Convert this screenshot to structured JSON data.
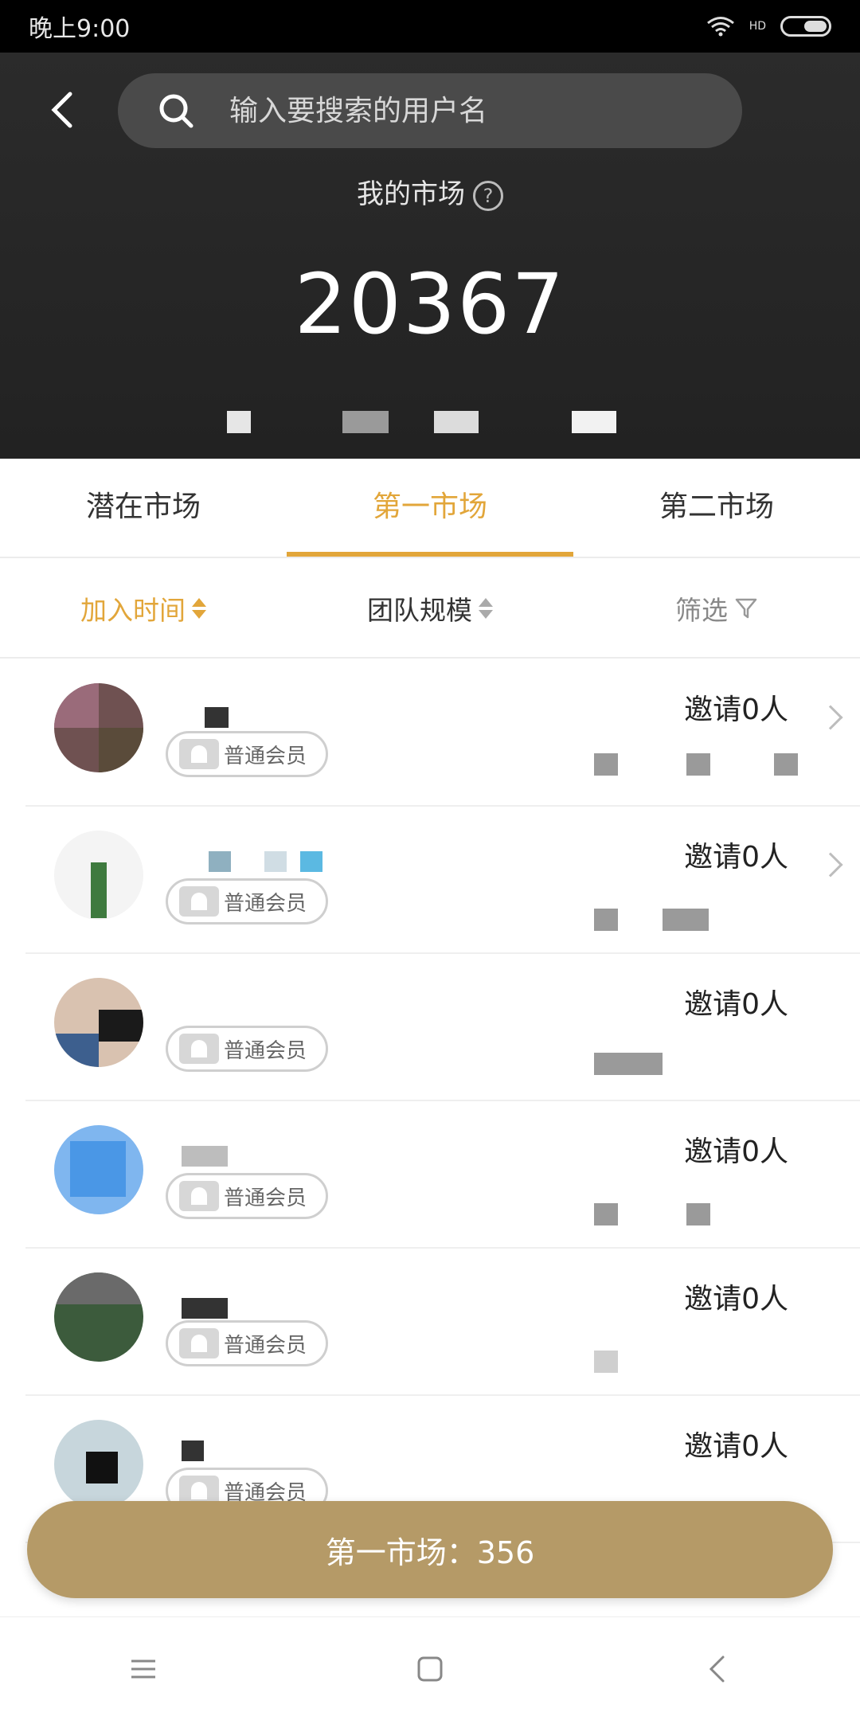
{
  "status_bar": {
    "time": "晚上9:00",
    "network": "HD"
  },
  "header": {
    "search_placeholder": "输入要搜索的用户名",
    "title": "我的市场",
    "help_symbol": "?",
    "count": "20367"
  },
  "tabs": [
    {
      "label": "潜在市场",
      "active": false
    },
    {
      "label": "第一市场",
      "active": true
    },
    {
      "label": "第二市场",
      "active": false
    }
  ],
  "sort": {
    "join_time": "加入时间",
    "team_size": "团队规模",
    "filter": "筛选"
  },
  "list": [
    {
      "badge": "普通会员",
      "invite": "邀请0人"
    },
    {
      "badge": "普通会员",
      "invite": "邀请0人"
    },
    {
      "badge": "普通会员",
      "invite": "邀请0人"
    },
    {
      "badge": "普通会员",
      "invite": "邀请0人"
    },
    {
      "badge": "普通会员",
      "invite": "邀请0人"
    },
    {
      "badge": "普通会员",
      "invite": "邀请0人"
    }
  ],
  "bottom_bar": {
    "text": "第一市场：356"
  },
  "colors": {
    "accent": "#e2a63a",
    "bottom_bar": "#b59a67",
    "header": "#262626"
  }
}
